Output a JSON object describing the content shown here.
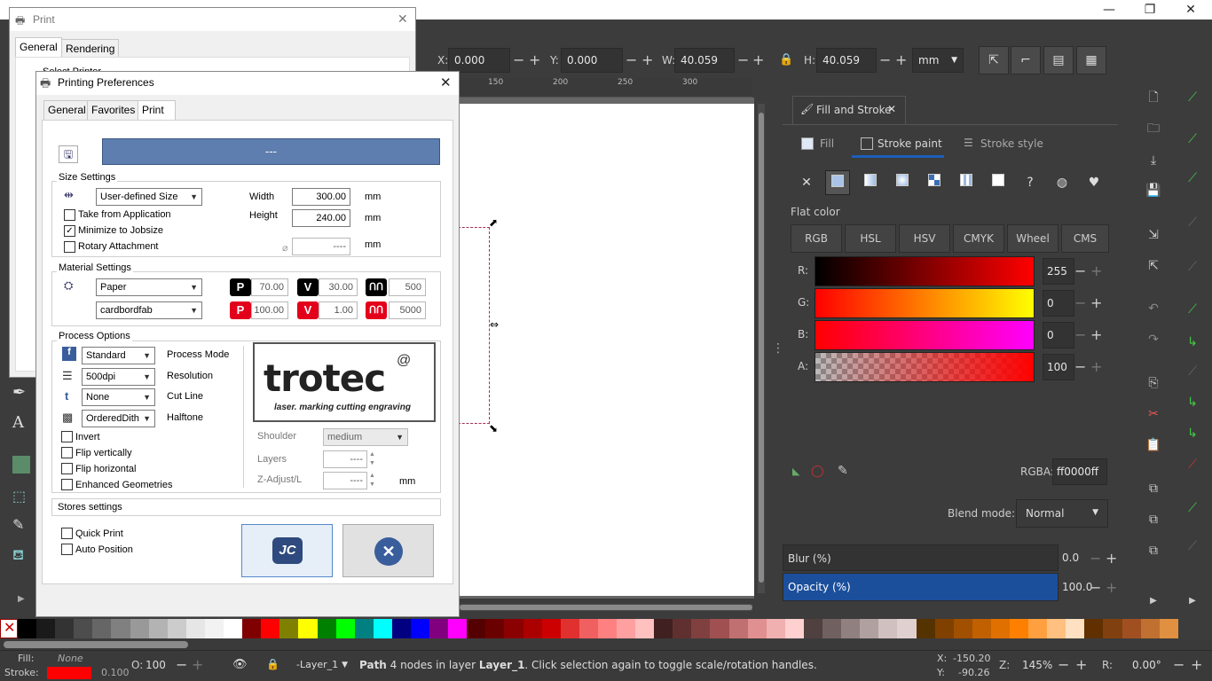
{
  "app": {
    "minimize": "—",
    "restore": "❐",
    "close": "✕"
  },
  "toolbar": {
    "x_label": "X:",
    "x_value": "0.000",
    "y_label": "Y:",
    "y_value": "0.000",
    "w_label": "W:",
    "w_value": "40.059",
    "h_label": "H:",
    "h_value": "40.059",
    "unit": "mm",
    "minus": "−",
    "plus": "+"
  },
  "ruler": {
    "ticks": [
      "150",
      "200",
      "250",
      "300"
    ]
  },
  "fill_stroke": {
    "tab_label": "Fill and Stroke",
    "tabs": [
      "Fill",
      "Stroke paint",
      "Stroke style"
    ],
    "flat_color": "Flat color",
    "modes": [
      "RGB",
      "HSL",
      "HSV",
      "CMYK",
      "Wheel",
      "CMS"
    ],
    "channels": [
      {
        "label": "R:",
        "value": "255"
      },
      {
        "label": "G:",
        "value": "0"
      },
      {
        "label": "B:",
        "value": "0"
      },
      {
        "label": "A:",
        "value": "100"
      }
    ],
    "rgba_label": "RGBA:",
    "rgba_value": "ff0000ff",
    "blend_label": "Blend mode:",
    "blend_value": "Normal",
    "blur_label": "Blur (%)",
    "blur_value": "0.0",
    "opacity_label": "Opacity (%)",
    "opacity_value": "100.0",
    "accent": "#1b4f9c"
  },
  "statusbar": {
    "fill_label": "Fill:",
    "fill_value": "None",
    "stroke_label": "Stroke:",
    "stroke_width": "0.100",
    "o_label": "O:",
    "o_value": "100",
    "layer": "-Layer_1",
    "message_prefix": "Path",
    "message_mid": " 4 nodes in layer ",
    "message_layer": "Layer_1",
    "message_suffix": ". Click selection again to toggle scale/rotation handles.",
    "x_label": "X:",
    "x_value": "-150.20",
    "y_label": "Y:",
    "y_value": "-90.26",
    "z_label": "Z:",
    "zoom": "145%",
    "r_label": "R:",
    "rotation": "0.00°"
  },
  "print_dialog": {
    "title": "Print",
    "tabs": [
      "General",
      "Rendering"
    ],
    "select_printer": "Select Printer"
  },
  "prefs_dialog": {
    "title": "Printing Preferences",
    "tabs": [
      "General",
      "Favorites",
      "Print"
    ],
    "job_name": "---",
    "size_settings": "Size Settings",
    "size_preset": "User-defined Size",
    "width_label": "Width",
    "width_value": "300.00",
    "height_label": "Height",
    "height_value": "240.00",
    "unit": "mm",
    "diameter_value": "----",
    "take_from_app": "Take from Application",
    "minimize_jobsize": "Minimize to Jobsize",
    "rotary": "Rotary Attachment",
    "material_settings": "Material Settings",
    "material": "Paper",
    "material_sub": "cardbordfab",
    "p1": "70.00",
    "v1": "30.00",
    "f1": "500",
    "p2": "100.00",
    "v2": "1.00",
    "f2": "5000",
    "process_options": "Process Options",
    "process_mode_value": "Standard",
    "process_mode_label": "Process Mode",
    "resolution_value": "500dpi",
    "resolution_label": "Resolution",
    "cutline_value": "None",
    "cutline_label": "Cut Line",
    "halftone_value": "OrderedDith",
    "halftone_label": "Halftone",
    "invert": "Invert",
    "flip_v": "Flip vertically",
    "flip_h": "Flip horizontal",
    "enhanced": "Enhanced Geometries",
    "logo_text": "trotec",
    "logo_tagline": "laser. marking cutting engraving",
    "shoulder_label": "Shoulder",
    "shoulder_value": "medium",
    "layers_label": "Layers",
    "layers_value": "----",
    "zadjust_label": "Z-Adjust/L",
    "zadjust_value": "----",
    "zadjust_unit": "mm",
    "stores_settings": "Stores settings",
    "quick_print": "Quick Print",
    "auto_position": "Auto Position",
    "ok_glyph": "JC",
    "close_glyph": "✕"
  }
}
